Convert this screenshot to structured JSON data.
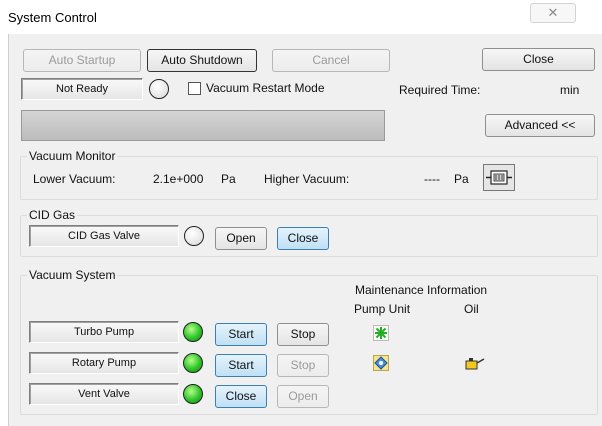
{
  "window": {
    "title": "System Control",
    "close_glyph": "✕"
  },
  "toolbar": {
    "auto_startup": "Auto Startup",
    "auto_shutdown": "Auto Shutdown",
    "cancel": "Cancel",
    "close": "Close",
    "advanced": "Advanced <<"
  },
  "status": {
    "state": "Not Ready",
    "vacuum_restart_mode": "Vacuum Restart Mode",
    "vacuum_restart_checked": false,
    "required_time_label": "Required Time:",
    "required_time_unit": "min"
  },
  "vacuum_monitor": {
    "title": "Vacuum Monitor",
    "lower_label": "Lower Vacuum:",
    "lower_value": "2.1e+000",
    "lower_unit": "Pa",
    "higher_label": "Higher Vacuum:",
    "higher_value": "----",
    "higher_unit": "Pa"
  },
  "cid_gas": {
    "title": "CID Gas",
    "valve_label": "CID Gas Valve",
    "valve_state": "off",
    "open": "Open",
    "close": "Close"
  },
  "vacuum_system": {
    "title": "Vacuum System",
    "maintenance_title": "Maintenance Information",
    "pump_unit_header": "Pump Unit",
    "oil_header": "Oil",
    "rows": [
      {
        "label": "Turbo Pump",
        "state": "on",
        "btn1": "Start",
        "btn2": "Stop"
      },
      {
        "label": "Rotary Pump",
        "state": "on",
        "btn1": "Start",
        "btn2": "Stop"
      },
      {
        "label": "Vent Valve",
        "state": "on",
        "btn1": "Close",
        "btn2": "Open"
      }
    ]
  },
  "colors": {
    "lamp_on": "#2fc42a",
    "button_highlight": "#bfe0f5",
    "window_bg": "#f0f0f0"
  },
  "icons": {
    "vacuum_gauge": "vacuum-gauge-icon",
    "turbo_pump_maintenance": "green-star-icon",
    "rotary_pump_maintenance": "blue-diamond-icon",
    "oil_can": "oil-can-icon"
  }
}
